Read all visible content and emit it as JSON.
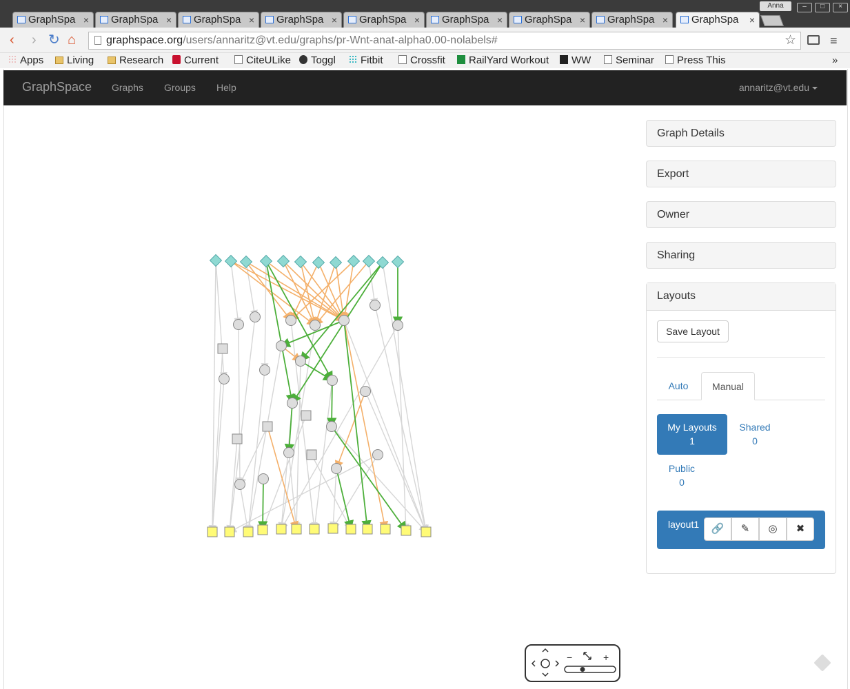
{
  "browser": {
    "tabs": [
      {
        "title": "GraphSpa",
        "active": false
      },
      {
        "title": "GraphSpa",
        "active": false
      },
      {
        "title": "GraphSpa",
        "active": false
      },
      {
        "title": "GraphSpa",
        "active": false
      },
      {
        "title": "GraphSpa",
        "active": false
      },
      {
        "title": "GraphSpa",
        "active": false
      },
      {
        "title": "GraphSpa",
        "active": false
      },
      {
        "title": "GraphSpa",
        "active": false
      },
      {
        "title": "GraphSpa",
        "active": true
      }
    ],
    "profile_name": "Anna",
    "url_host": "graphspace.org",
    "url_path": "/users/annaritz@vt.edu/graphs/pr-Wnt-anat-alpha0.00-nolabels#",
    "bookmarks": [
      {
        "label": "Apps",
        "icon": "apps-icon"
      },
      {
        "label": "Living",
        "icon": "folder-icon"
      },
      {
        "label": "Research",
        "icon": "folder-icon"
      },
      {
        "label": "Current",
        "icon": "current-icon"
      },
      {
        "label": "CiteULike",
        "icon": "page-icon"
      },
      {
        "label": "Toggl",
        "icon": "toggl-icon"
      },
      {
        "label": "Fitbit",
        "icon": "fitbit-icon"
      },
      {
        "label": "Crossfit",
        "icon": "page-icon"
      },
      {
        "label": "RailYard Workout",
        "icon": "sheet-icon"
      },
      {
        "label": "WW",
        "icon": "ww-icon"
      },
      {
        "label": "Seminar",
        "icon": "page-icon"
      },
      {
        "label": "Press This",
        "icon": "page-icon"
      }
    ]
  },
  "navbar": {
    "brand": "GraphSpace",
    "links": [
      "Graphs",
      "Groups",
      "Help"
    ],
    "user": "annaritz@vt.edu"
  },
  "sidebar": {
    "panels": [
      "Graph Details",
      "Export",
      "Owner",
      "Sharing"
    ],
    "layouts": {
      "title": "Layouts",
      "save_label": "Save Layout",
      "tabs": [
        "Auto",
        "Manual"
      ],
      "my_layouts": {
        "label": "My Layouts",
        "count": "1"
      },
      "shared": {
        "label": "Shared",
        "count": "0"
      },
      "public": {
        "label": "Public",
        "count": "0"
      },
      "items": [
        {
          "name": "layout1"
        }
      ]
    }
  },
  "graph": {
    "colors": {
      "source": "#8fd9d2",
      "target": "#fffb77",
      "intermediate": "#dddddd",
      "edge_gray": "#d6d6d6",
      "edge_green": "#4caf3a",
      "edge_orange": "#f4b06a"
    }
  }
}
